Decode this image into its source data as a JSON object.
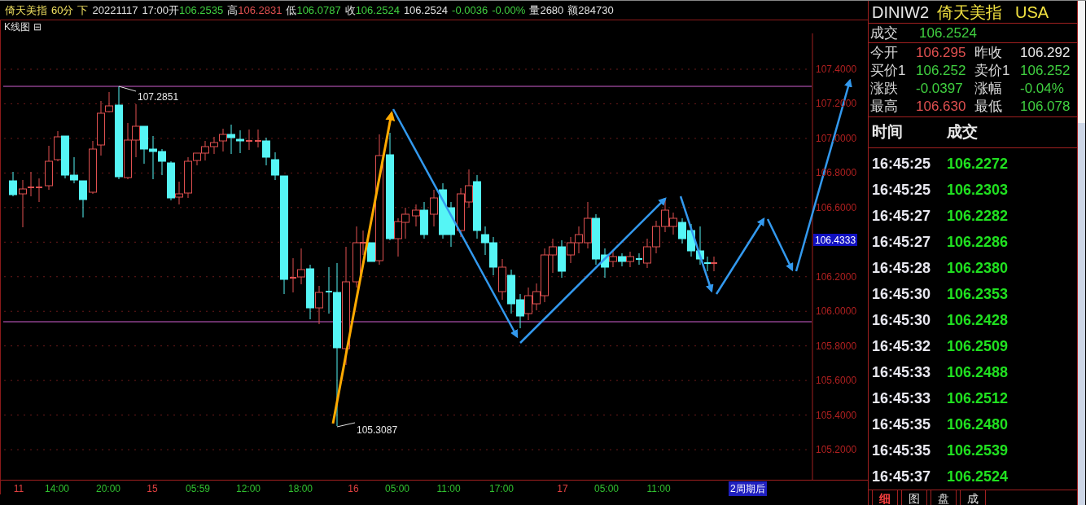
{
  "header": {
    "groups": [
      {
        "parts": [
          {
            "text": "倚天美指",
            "kind": "name"
          }
        ]
      },
      {
        "parts": [
          {
            "text": "60分",
            "kind": "name"
          }
        ]
      },
      {
        "parts": [
          {
            "text": "下",
            "kind": "name"
          }
        ]
      },
      {
        "parts": [
          {
            "text": "20221117",
            "kind": "label"
          }
        ]
      },
      {
        "parts": [
          {
            "text": "17:00开",
            "kind": "label"
          },
          {
            "text": "106.2535",
            "kind": "down"
          }
        ]
      },
      {
        "parts": [
          {
            "text": "高",
            "kind": "label"
          },
          {
            "text": "106.2831",
            "kind": "up"
          }
        ]
      },
      {
        "parts": [
          {
            "text": "低",
            "kind": "label"
          },
          {
            "text": "106.0787",
            "kind": "down"
          }
        ]
      },
      {
        "parts": [
          {
            "text": "收",
            "kind": "label"
          },
          {
            "text": "106.2524",
            "kind": "down"
          }
        ]
      },
      {
        "parts": [
          {
            "text": "106.2524",
            "kind": "label"
          }
        ]
      },
      {
        "parts": [
          {
            "text": "-0.0036",
            "kind": "down"
          }
        ]
      },
      {
        "parts": [
          {
            "text": "-0.00%",
            "kind": "down"
          }
        ]
      },
      {
        "parts": [
          {
            "text": "量2680",
            "kind": "label"
          }
        ]
      },
      {
        "parts": [
          {
            "text": "额284730",
            "kind": "label"
          }
        ]
      }
    ]
  },
  "chart": {
    "title": "K线图",
    "collapse_glyph": "⊟",
    "high_annotation": "107.2851",
    "low_annotation": "105.3087",
    "y_axis_labels": [
      "107.4000",
      "107.2000",
      "107.0000",
      "106.8000",
      "106.6000",
      "106.2000",
      "106.0000",
      "105.8000",
      "105.6000",
      "105.4000",
      "105.2000"
    ],
    "current_price": "106.4333",
    "x_axis_labels": [
      {
        "label": "11",
        "kind": "day"
      },
      {
        "label": "14:00",
        "kind": "time"
      },
      {
        "label": "20:00",
        "kind": "time"
      },
      {
        "label": "15",
        "kind": "day"
      },
      {
        "label": "05:59",
        "kind": "time"
      },
      {
        "label": "12:00",
        "kind": "time"
      },
      {
        "label": "18:00",
        "kind": "time"
      },
      {
        "label": "16",
        "kind": "day"
      },
      {
        "label": "05:00",
        "kind": "time"
      },
      {
        "label": "11:00",
        "kind": "time"
      },
      {
        "label": "17:00",
        "kind": "time"
      },
      {
        "label": "17",
        "kind": "day"
      },
      {
        "label": "05:00",
        "kind": "time"
      },
      {
        "label": "11:00",
        "kind": "time"
      }
    ],
    "future_label": "2周期后"
  },
  "quote": {
    "symbol": "DINIW2",
    "name": "倚天美指",
    "market": "USA",
    "last": {
      "label": "成交",
      "value": "106.2524",
      "kind": "down"
    },
    "rows": [
      [
        {
          "label": "今开",
          "value": "106.295",
          "kind": "up"
        },
        {
          "label": "昨收",
          "value": "106.292",
          "kind": "flat"
        }
      ],
      [
        {
          "label": "买价1",
          "value": "106.252",
          "kind": "down"
        },
        {
          "label": "卖价1",
          "value": "106.252",
          "kind": "down"
        }
      ],
      [
        {
          "label": "涨跌",
          "value": "-0.0397",
          "kind": "down"
        },
        {
          "label": "涨幅",
          "value": "-0.04%",
          "kind": "down"
        }
      ],
      [
        {
          "label": "最高",
          "value": "106.630",
          "kind": "up"
        },
        {
          "label": "最低",
          "value": "106.078",
          "kind": "down"
        }
      ]
    ]
  },
  "ticks": {
    "columns": [
      "时间",
      "成交"
    ],
    "rows": [
      {
        "time": "16:45:25",
        "price": "106.2272"
      },
      {
        "time": "16:45:25",
        "price": "106.2303"
      },
      {
        "time": "16:45:27",
        "price": "106.2282"
      },
      {
        "time": "16:45:27",
        "price": "106.2286"
      },
      {
        "time": "16:45:28",
        "price": "106.2380"
      },
      {
        "time": "16:45:30",
        "price": "106.2353"
      },
      {
        "time": "16:45:30",
        "price": "106.2428"
      },
      {
        "time": "16:45:32",
        "price": "106.2509"
      },
      {
        "time": "16:45:33",
        "price": "106.2488"
      },
      {
        "time": "16:45:33",
        "price": "106.2512"
      },
      {
        "time": "16:45:35",
        "price": "106.2480"
      },
      {
        "time": "16:45:35",
        "price": "106.2539"
      },
      {
        "time": "16:45:37",
        "price": "106.2524"
      }
    ]
  },
  "tabs": [
    {
      "label": "细",
      "selected": true
    },
    {
      "label": "图",
      "selected": false
    },
    {
      "label": "盘",
      "selected": false
    },
    {
      "label": "成",
      "selected": false
    }
  ]
}
